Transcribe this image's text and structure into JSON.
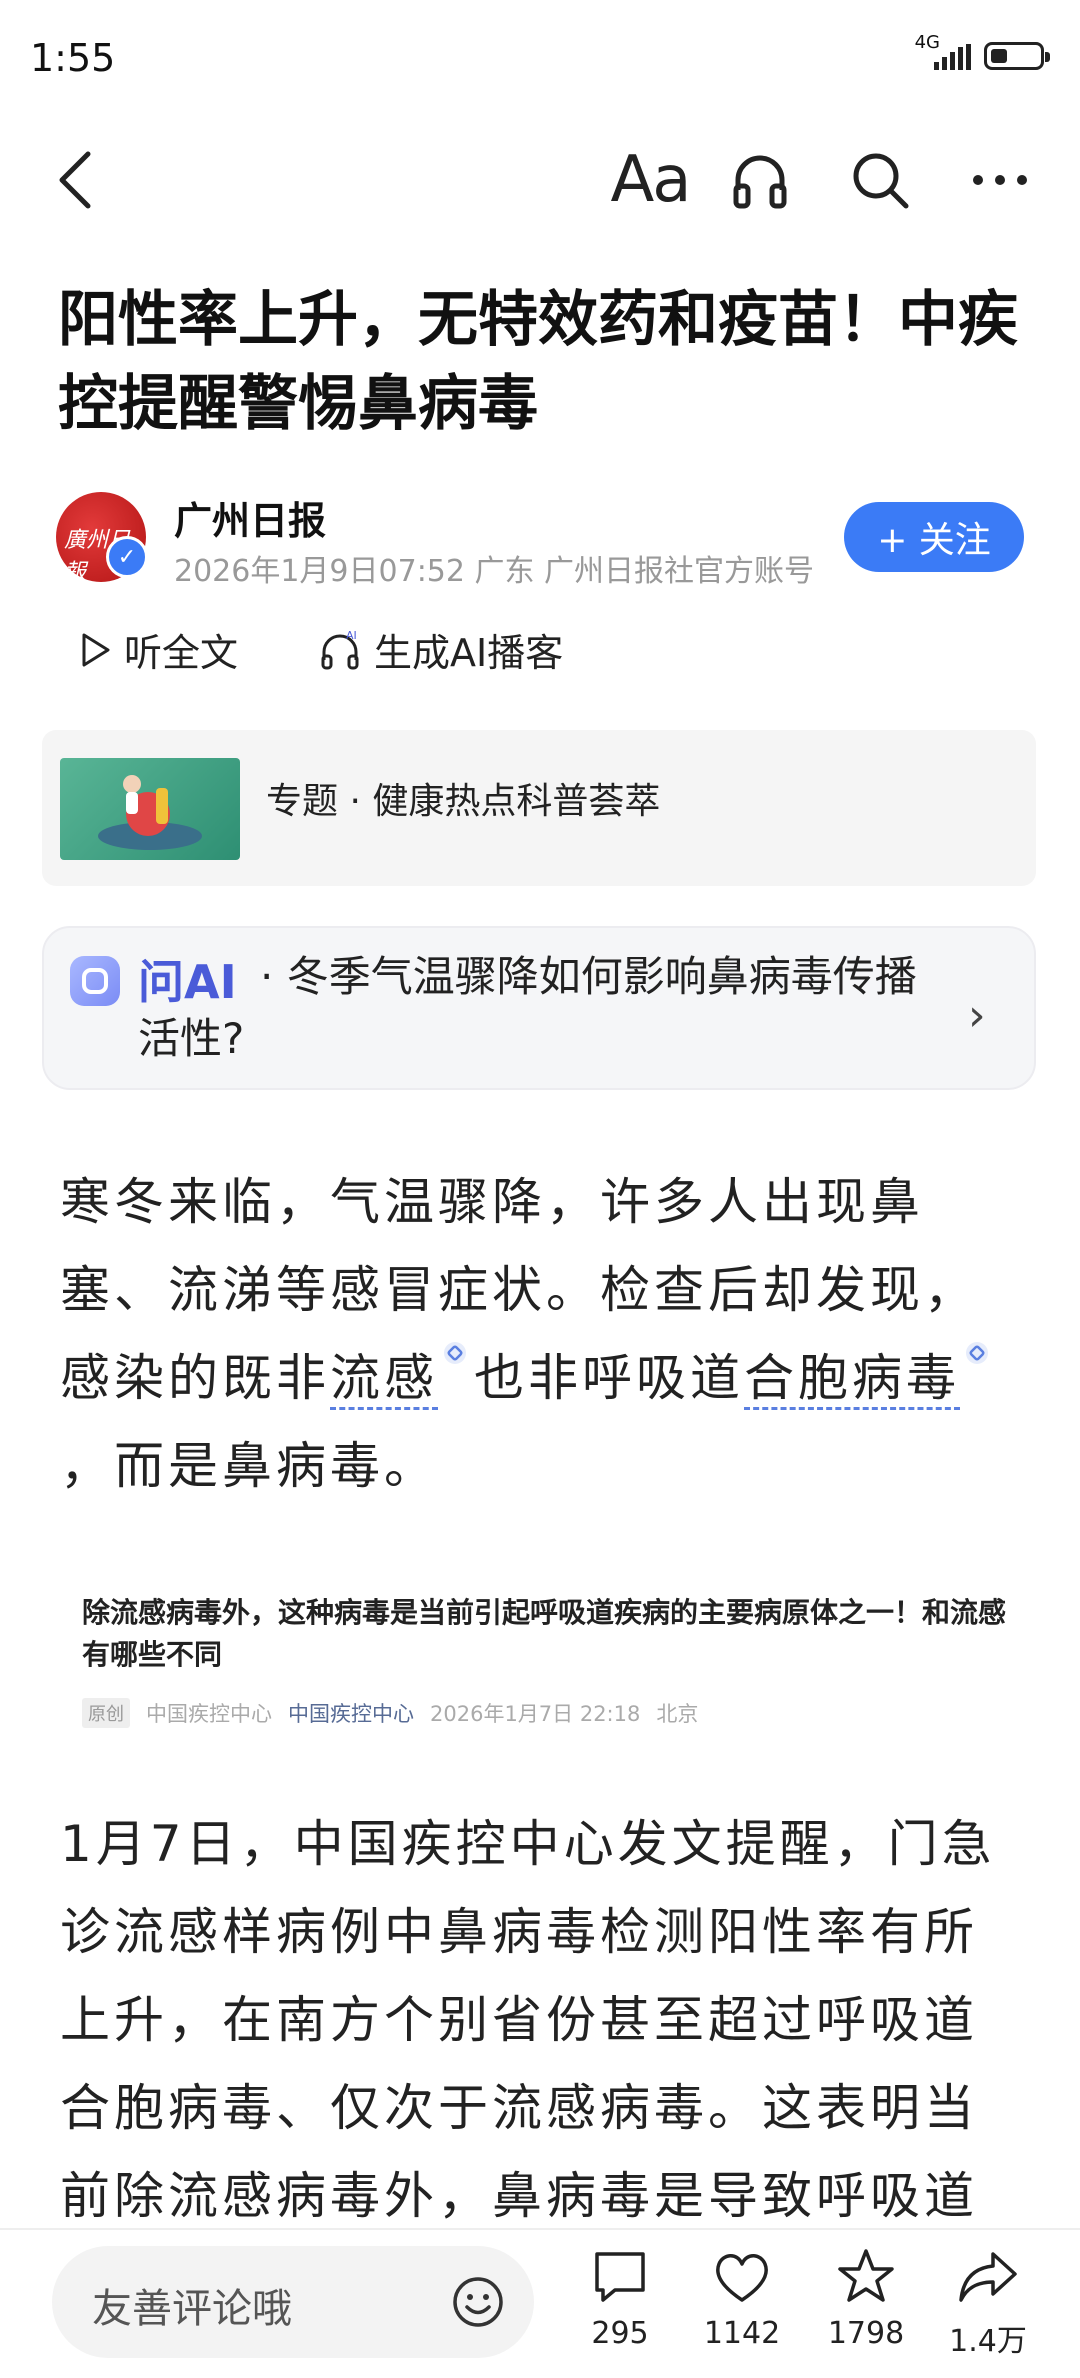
{
  "status_bar": {
    "time": "1:55",
    "network": "4G"
  },
  "toolbar": {
    "back": "back-arrow-icon",
    "font": "Aa",
    "listen": "headphones-icon",
    "search": "search-icon",
    "more": "more-dots-icon"
  },
  "article": {
    "title": "阳性率上升，无特效药和疫苗！中疾控提醒警惕鼻病毒",
    "source_name": "广州日报",
    "meta": "2026年1月9日07:52 广东 广州日报社官方账号",
    "follow_label": "+ 关注",
    "listen_label": "听全文",
    "podcast_label": "生成AI播客"
  },
  "topic": {
    "label": "专题 · 健康热点科普荟萃"
  },
  "ask_ai": {
    "label": "问AI",
    "question": "· 冬季气温骤降如何影响鼻病毒传播活性?"
  },
  "body": {
    "p1_a": "寒冬来临，气温骤降，许多人出现鼻塞、流涕等感冒症状。检查后却发现，感染的既非",
    "p1_term1": "流感",
    "p1_b": "也非呼吸道",
    "p1_term2": "合胞病毒",
    "p1_c": "，而是鼻病毒。",
    "p2": "1月7日，中国疾控中心发文提醒，门急诊流感样病例中鼻病毒检测阳性率有所上升，在南方个别省份甚至超过呼吸道合胞病毒、仅次于流感病毒。这表明当前除流感病毒外，鼻病毒是导致呼吸道症状的主"
  },
  "embedded": {
    "title": "除流感病毒外，这种病毒是当前引起呼吸道疾病的主要病原体之一！和流感有哪些不同",
    "tag": "原创",
    "author": "中国疾控中心",
    "account": "中国疾控中心",
    "date": "2026年1月7日 22:18",
    "location": "北京"
  },
  "bottom_bar": {
    "comment_placeholder": "友善评论哦",
    "comments": "295",
    "likes": "1142",
    "favorites": "1798",
    "shares": "1.4万"
  },
  "colors": {
    "accent": "#3b7bf6",
    "ai_blue": "#4a5bd8",
    "link": "#576b95"
  }
}
